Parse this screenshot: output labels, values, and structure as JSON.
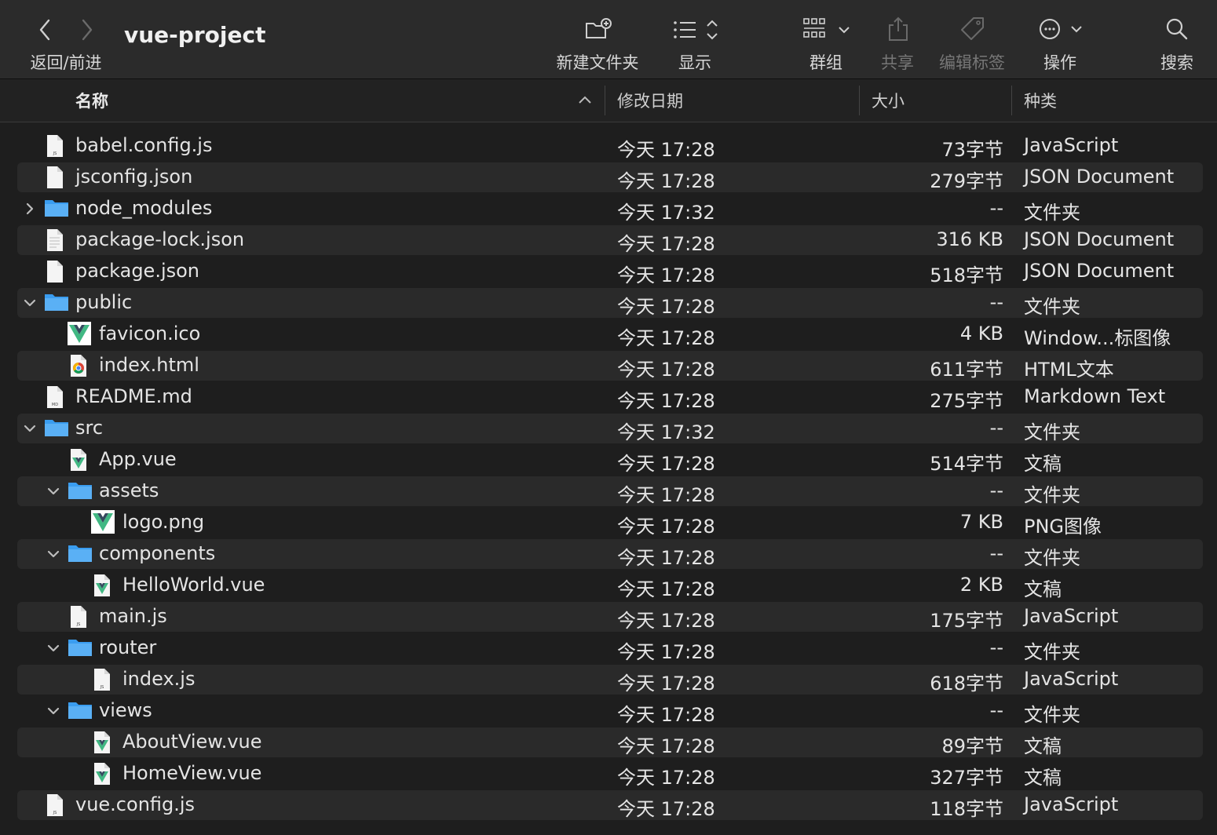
{
  "window": {
    "title": "vue-project"
  },
  "toolbar": {
    "nav_label": "返回/前进",
    "new_folder": "新建文件夹",
    "view": "显示",
    "group": "群组",
    "share": "共享",
    "edit_tags": "编辑标签",
    "action": "操作",
    "search": "搜索"
  },
  "columns": {
    "name": "名称",
    "date": "修改日期",
    "size": "大小",
    "kind": "种类"
  },
  "rows": [
    {
      "name": "babel.config.js",
      "date": "今天 17:28",
      "size": "73字节",
      "kind": "JavaScript",
      "icon": "js-file-icon",
      "level": 0,
      "disclosure": ""
    },
    {
      "name": "jsconfig.json",
      "date": "今天 17:28",
      "size": "279字节",
      "kind": "JSON Document",
      "icon": "file-icon",
      "level": 0,
      "disclosure": ""
    },
    {
      "name": "node_modules",
      "date": "今天 17:32",
      "size": "--",
      "kind": "文件夹",
      "icon": "folder-icon",
      "level": 0,
      "disclosure": "collapsed"
    },
    {
      "name": "package-lock.json",
      "date": "今天 17:28",
      "size": "316 KB",
      "kind": "JSON Document",
      "icon": "text-file-icon",
      "level": 0,
      "disclosure": ""
    },
    {
      "name": "package.json",
      "date": "今天 17:28",
      "size": "518字节",
      "kind": "JSON Document",
      "icon": "file-icon",
      "level": 0,
      "disclosure": ""
    },
    {
      "name": "public",
      "date": "今天 17:28",
      "size": "--",
      "kind": "文件夹",
      "icon": "folder-icon",
      "level": 0,
      "disclosure": "expanded"
    },
    {
      "name": "favicon.ico",
      "date": "今天 17:28",
      "size": "4 KB",
      "kind": "Window...标图像",
      "icon": "vue-logo-icon",
      "level": 1,
      "disclosure": ""
    },
    {
      "name": "index.html",
      "date": "今天 17:28",
      "size": "611字节",
      "kind": "HTML文本",
      "icon": "chrome-file-icon",
      "level": 1,
      "disclosure": ""
    },
    {
      "name": "README.md",
      "date": "今天 17:28",
      "size": "275字节",
      "kind": "Markdown Text",
      "icon": "md-file-icon",
      "level": 0,
      "disclosure": ""
    },
    {
      "name": "src",
      "date": "今天 17:32",
      "size": "--",
      "kind": "文件夹",
      "icon": "folder-icon",
      "level": 0,
      "disclosure": "expanded"
    },
    {
      "name": "App.vue",
      "date": "今天 17:28",
      "size": "514字节",
      "kind": "文稿",
      "icon": "vue-file-icon",
      "level": 1,
      "disclosure": ""
    },
    {
      "name": "assets",
      "date": "今天 17:28",
      "size": "--",
      "kind": "文件夹",
      "icon": "folder-icon",
      "level": 1,
      "disclosure": "expanded"
    },
    {
      "name": "logo.png",
      "date": "今天 17:28",
      "size": "7 KB",
      "kind": "PNG图像",
      "icon": "vue-logo-icon",
      "level": 2,
      "disclosure": ""
    },
    {
      "name": "components",
      "date": "今天 17:28",
      "size": "--",
      "kind": "文件夹",
      "icon": "folder-icon",
      "level": 1,
      "disclosure": "expanded"
    },
    {
      "name": "HelloWorld.vue",
      "date": "今天 17:28",
      "size": "2 KB",
      "kind": "文稿",
      "icon": "vue-file-icon",
      "level": 2,
      "disclosure": ""
    },
    {
      "name": "main.js",
      "date": "今天 17:28",
      "size": "175字节",
      "kind": "JavaScript",
      "icon": "js-file-icon",
      "level": 1,
      "disclosure": ""
    },
    {
      "name": "router",
      "date": "今天 17:28",
      "size": "--",
      "kind": "文件夹",
      "icon": "folder-icon",
      "level": 1,
      "disclosure": "expanded"
    },
    {
      "name": "index.js",
      "date": "今天 17:28",
      "size": "618字节",
      "kind": "JavaScript",
      "icon": "js-file-icon",
      "level": 2,
      "disclosure": ""
    },
    {
      "name": "views",
      "date": "今天 17:28",
      "size": "--",
      "kind": "文件夹",
      "icon": "folder-icon",
      "level": 1,
      "disclosure": "expanded"
    },
    {
      "name": "AboutView.vue",
      "date": "今天 17:28",
      "size": "89字节",
      "kind": "文稿",
      "icon": "vue-file-icon",
      "level": 2,
      "disclosure": ""
    },
    {
      "name": "HomeView.vue",
      "date": "今天 17:28",
      "size": "327字节",
      "kind": "文稿",
      "icon": "vue-file-icon",
      "level": 2,
      "disclosure": ""
    },
    {
      "name": "vue.config.js",
      "date": "今天 17:28",
      "size": "118字节",
      "kind": "JavaScript",
      "icon": "js-file-icon",
      "level": 0,
      "disclosure": ""
    }
  ],
  "colors": {
    "folder": "#3a9df0",
    "vue_green": "#41b883",
    "vue_dark": "#35495e"
  }
}
